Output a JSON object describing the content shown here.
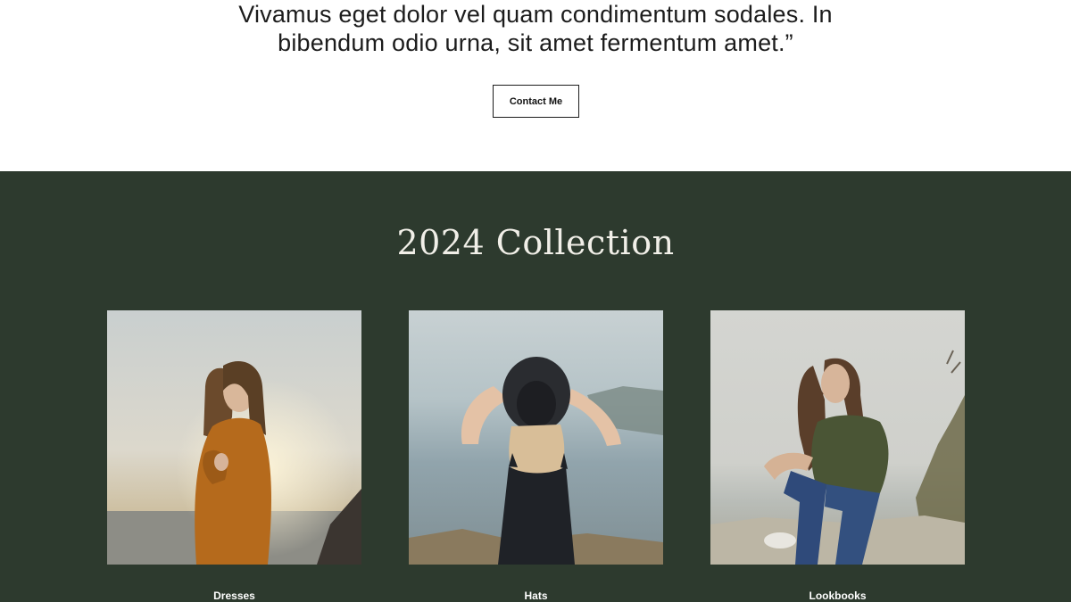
{
  "quote": {
    "lines": [
      "Vivamus eget dolor vel quam condimentum sodales. In",
      "bibendum odio urna, sit amet fermentum amet.”"
    ],
    "contact_label": "Contact Me"
  },
  "collection": {
    "title": "2024 Collection",
    "items": [
      {
        "label": "Dresses",
        "image": "woman-orange-sweater-photo"
      },
      {
        "label": "Hats",
        "image": "woman-black-hat-photo"
      },
      {
        "label": "Lookbooks",
        "image": "woman-sitting-rocks-photo"
      }
    ]
  },
  "colors": {
    "section_bg": "#2d3a2e",
    "text_dark": "#1c1c1c",
    "title_light": "#f1efe8"
  }
}
